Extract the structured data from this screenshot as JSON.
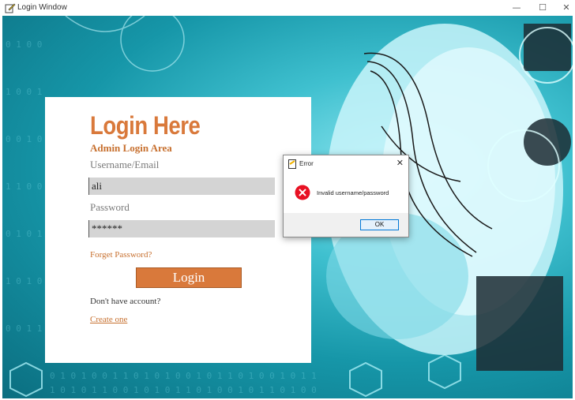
{
  "window": {
    "title": "Login Window",
    "controls": {
      "minimize": "—",
      "maximize": "☐",
      "close": "✕"
    },
    "icon": "pen-icon"
  },
  "login": {
    "heading": "Login Here",
    "subheading": "Admin Login Area",
    "username_label": "Username/Email",
    "username_value": "ali",
    "password_label": "Password",
    "password_value": "******",
    "forgot_label": "Forget Password?",
    "login_button": "Login",
    "no_account_text": "Don't have account?",
    "create_link": "Create one",
    "accent_color": "#d9793b"
  },
  "error_dialog": {
    "title": "Error",
    "close": "✕",
    "message": "Invalid username/password",
    "ok_label": "OK",
    "icon": "error-icon"
  }
}
